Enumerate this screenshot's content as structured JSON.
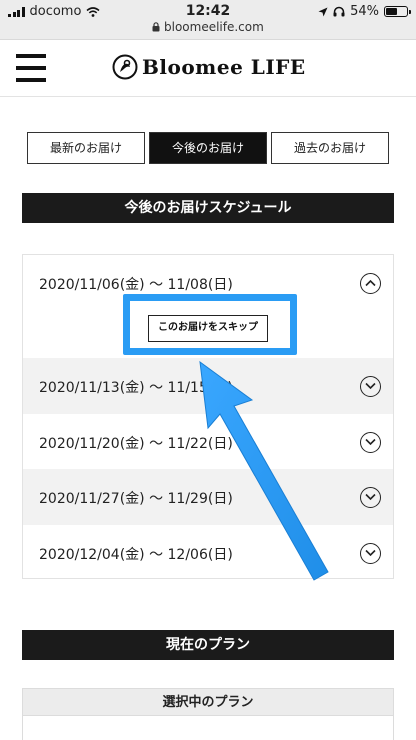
{
  "status_bar": {
    "carrier": "docomo",
    "time": "12:42",
    "url": "bloomeelife.com",
    "battery": "54%",
    "battery_level": 0.54
  },
  "header": {
    "logo_text": "Bloomee LIFE",
    "menu_icon": "hamburger-menu-icon"
  },
  "tabs": [
    {
      "label": "最新のお届け",
      "active": false
    },
    {
      "label": "今後のお届け",
      "active": true
    },
    {
      "label": "過去のお届け",
      "active": false
    }
  ],
  "schedule": {
    "title": "今後のお届けスケジュール",
    "skip_label": "このお届けをスキップ",
    "items": [
      {
        "date": "2020/11/06(金) 〜 11/08(日)",
        "expanded": true
      },
      {
        "date": "2020/11/13(金) 〜 11/15(日)",
        "expanded": false
      },
      {
        "date": "2020/11/20(金) 〜 11/22(日)",
        "expanded": false
      },
      {
        "date": "2020/11/27(金) 〜 11/29(日)",
        "expanded": false
      },
      {
        "date": "2020/12/04(金) 〜 12/06(日)",
        "expanded": false
      }
    ]
  },
  "plan": {
    "title": "現在のプラン",
    "selected_label": "選択中のプラン"
  },
  "colors": {
    "highlight": "#2a9cf4",
    "section_bar": "#1b1b1b",
    "row_alt": "#f2f2f2"
  }
}
